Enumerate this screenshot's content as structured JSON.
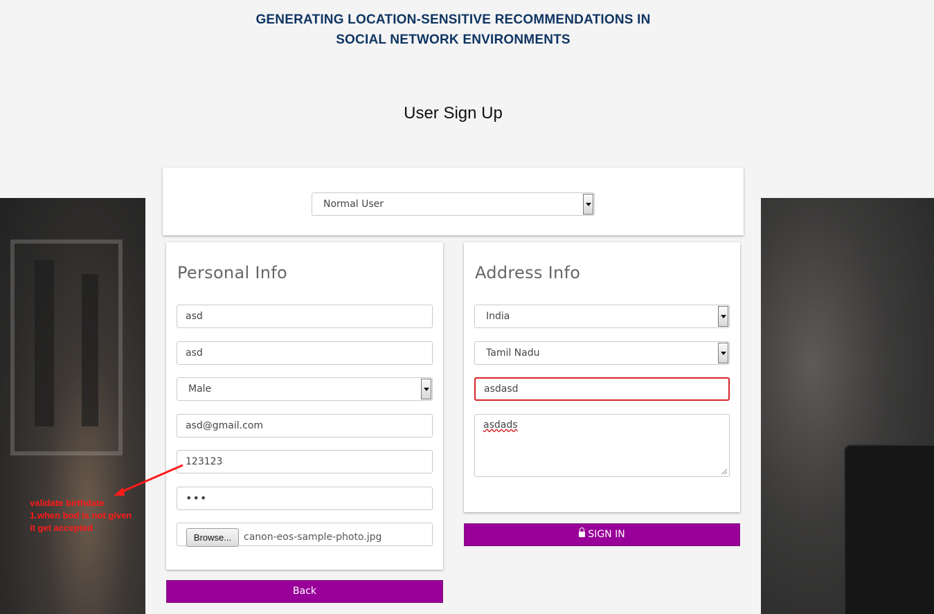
{
  "site_title_line1": "GENERATING LOCATION-SENSITIVE RECOMMENDATIONS IN",
  "site_title_line2": "SOCIAL NETWORK ENVIRONMENTS",
  "page_heading": "User Sign Up",
  "user_type": {
    "selected": "Normal User"
  },
  "personal": {
    "heading": "Personal Info",
    "first_name": "asd",
    "last_name": "asd",
    "gender": "Male",
    "email": "asd@gmail.com",
    "birthdate": "123123",
    "password": "•••",
    "browse_label": "Browse...",
    "file_name": "canon-eos-sample-photo.jpg"
  },
  "address": {
    "heading": "Address Info",
    "country": "India",
    "state": "Tamil Nadu",
    "city": "asdasd",
    "address_text": "asdads"
  },
  "buttons": {
    "back": "Back",
    "sign_in": "SIGN IN"
  },
  "annotation": {
    "line1": "validate birthdate",
    "line2": "1.when bod is not given",
    "line3": "it get accepted",
    "color": "#ff1a1a"
  },
  "colors": {
    "title": "#0f3562",
    "button": "#990099",
    "error_border": "#d6232a"
  }
}
